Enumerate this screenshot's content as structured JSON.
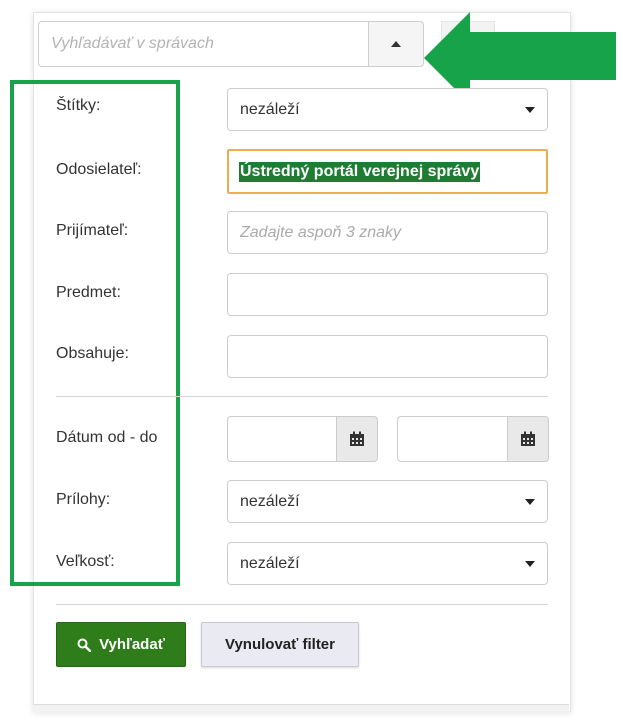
{
  "search": {
    "placeholder": "Vyhľadávať v správach"
  },
  "filters": {
    "tags": {
      "label": "Štítky:",
      "value": "nezáleží"
    },
    "sender": {
      "label": "Odosielateľ:",
      "value": "Ústredný portál verejnej správy"
    },
    "recipient": {
      "label": "Prijímateľ:",
      "placeholder": "Zadajte aspoň 3 znaky"
    },
    "subject": {
      "label": "Predmet:",
      "value": ""
    },
    "contains": {
      "label": "Obsahuje:",
      "value": ""
    },
    "date_range": {
      "label": "Dátum od - do",
      "from": "",
      "to": ""
    },
    "attachments": {
      "label": "Prílohy:",
      "value": "nezáleží"
    },
    "size": {
      "label": "Veľkosť:",
      "value": "nezáleží"
    }
  },
  "actions": {
    "search_label": "Vyhľadať",
    "reset_label": "Vynulovať filter"
  },
  "colors": {
    "highlight": "#16a34a",
    "search_button": "#2e7d1a",
    "focus_border": "#f0ad4e"
  }
}
